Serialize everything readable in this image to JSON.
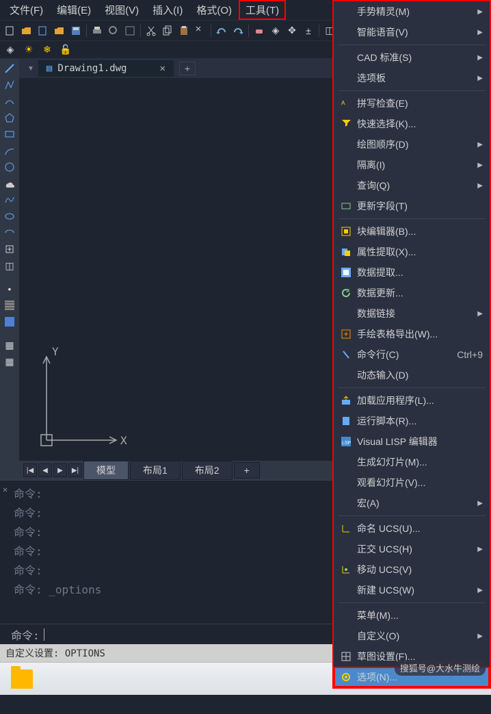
{
  "menubar": {
    "items": [
      {
        "label": "文件(F)"
      },
      {
        "label": "编辑(E)"
      },
      {
        "label": "视图(V)"
      },
      {
        "label": "插入(I)"
      },
      {
        "label": "格式(O)"
      },
      {
        "label": "工具(T)"
      }
    ],
    "active_index": 5
  },
  "document": {
    "tab_name": "Drawing1.dwg"
  },
  "layout_tabs": {
    "tabs": [
      "模型",
      "布局1",
      "布局2"
    ],
    "add": "+"
  },
  "command_history": {
    "lines": [
      "命令:",
      "命令:",
      "命令:",
      "命令:",
      "命令:",
      "命令: _options"
    ]
  },
  "command_input": {
    "prompt": "命令:"
  },
  "statusbar": {
    "text": "自定义设置: OPTIONS"
  },
  "tools_menu": {
    "items": [
      {
        "label": "手势精灵(M)",
        "arrow": true,
        "sep": false
      },
      {
        "label": "智能语音(V)",
        "arrow": true,
        "sep": true
      },
      {
        "label": "CAD 标准(S)",
        "arrow": true,
        "sep": false
      },
      {
        "label": "选项板",
        "arrow": true,
        "sep": true
      },
      {
        "label": "拼写检查(E)",
        "icon": "spell",
        "sep": false
      },
      {
        "label": "快速选择(K)...",
        "icon": "qselect",
        "sep": false
      },
      {
        "label": "绘图顺序(D)",
        "arrow": true,
        "sep": false
      },
      {
        "label": "隔离(I)",
        "arrow": true,
        "sep": false
      },
      {
        "label": "查询(Q)",
        "arrow": true,
        "sep": false
      },
      {
        "label": "更新字段(T)",
        "icon": "field",
        "sep": true
      },
      {
        "label": "块编辑器(B)...",
        "icon": "block",
        "sep": false
      },
      {
        "label": "属性提取(X)...",
        "icon": "attr",
        "sep": false
      },
      {
        "label": "数据提取...",
        "icon": "data",
        "sep": false
      },
      {
        "label": "数据更新...",
        "icon": "refresh",
        "sep": false
      },
      {
        "label": "数据链接",
        "arrow": true,
        "sep": false
      },
      {
        "label": "手绘表格导出(W)...",
        "icon": "export",
        "sep": false
      },
      {
        "label": "命令行(C)",
        "shortcut": "Ctrl+9",
        "icon": "cmd",
        "sep": false
      },
      {
        "label": "动态输入(D)",
        "sep": true
      },
      {
        "label": "加载应用程序(L)...",
        "icon": "load",
        "sep": false
      },
      {
        "label": "运行脚本(R)...",
        "icon": "script",
        "sep": false
      },
      {
        "label": "Visual LISP 编辑器",
        "icon": "lisp",
        "sep": false
      },
      {
        "label": "生成幻灯片(M)...",
        "sep": false
      },
      {
        "label": "观看幻灯片(V)...",
        "sep": false
      },
      {
        "label": "宏(A)",
        "arrow": true,
        "sep": true
      },
      {
        "label": "命名 UCS(U)...",
        "icon": "ucs",
        "sep": false
      },
      {
        "label": "正交 UCS(H)",
        "arrow": true,
        "sep": false
      },
      {
        "label": "移动 UCS(V)",
        "icon": "move",
        "sep": false
      },
      {
        "label": "新建 UCS(W)",
        "arrow": true,
        "sep": true
      },
      {
        "label": "菜单(M)...",
        "sep": false
      },
      {
        "label": "自定义(O)",
        "arrow": true,
        "sep": false
      },
      {
        "label": "草图设置(F)...",
        "icon": "draft",
        "sep": false
      },
      {
        "label": "选项(N)...",
        "icon": "gear",
        "selected": true,
        "sep": false
      }
    ]
  },
  "watermark": {
    "text": "搜狐号@大水牛测绘"
  },
  "axis": {
    "x": "X",
    "y": "Y"
  }
}
